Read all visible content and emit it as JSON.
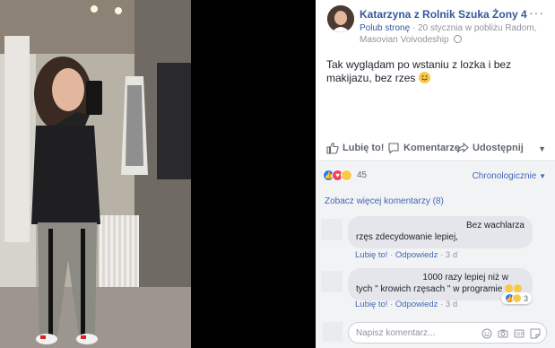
{
  "post": {
    "author": "Katarzyna z Rolnik Szuka Żony 4",
    "like_page": "Polub stronę",
    "meta": "20 stycznia w pobliżu Radom, Masovian Voivodeship",
    "more": "···",
    "text": "Tak wyglądam po wstaniu z lozka i bez makijazu, bez rzes"
  },
  "actions": {
    "like": "Lubię to!",
    "comment": "Komentarze",
    "share": "Udostępnij"
  },
  "reactions": {
    "count": "45",
    "order": "Chronologicznie"
  },
  "comments": {
    "view_more": "Zobacz więcej komentarzy (8)",
    "items": [
      {
        "line1": "Bez wachlarza",
        "line2": "rzęs zdecydowanie lepiej,",
        "like": "Lubię to!",
        "reply": "Odpowiedz",
        "time": "3 d"
      },
      {
        "line1": "1000 razy lepiej niż w",
        "line2": "tych \" krowich rzęsach \" w programie",
        "like": "Lubię to!",
        "reply": "Odpowiedz",
        "time": "3 d",
        "reaction_count": "3"
      }
    ]
  },
  "composer": {
    "placeholder": "Napisz komentarz..."
  },
  "colors": {
    "link": "#365899",
    "accent": "#4267b2",
    "like": "#2078f4",
    "love": "#f33e58",
    "haha": "#f7c948"
  }
}
